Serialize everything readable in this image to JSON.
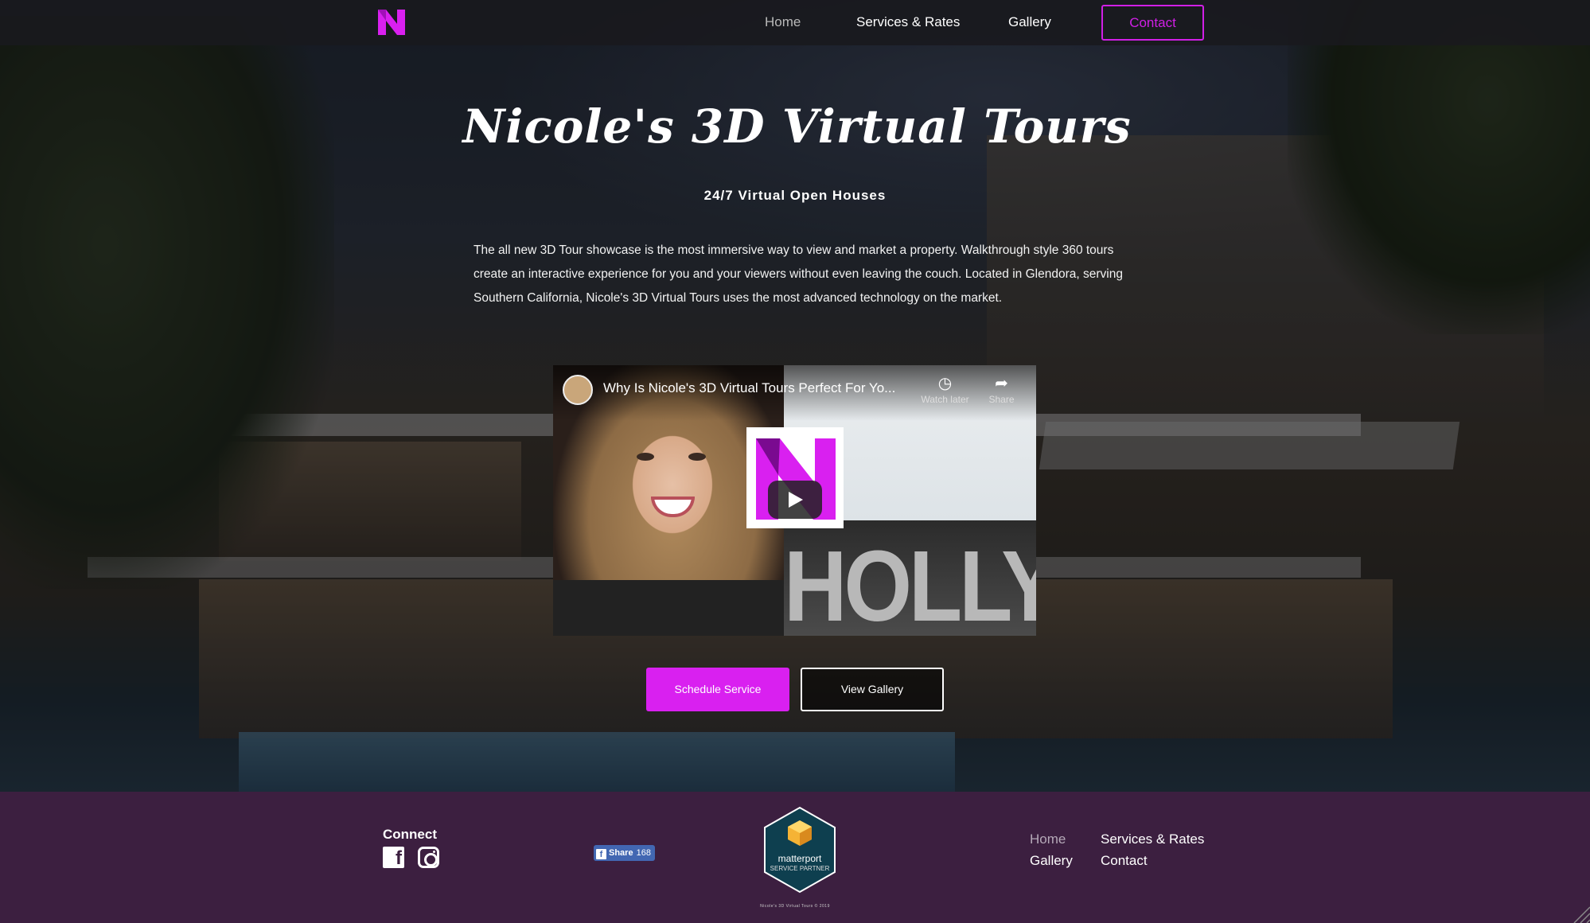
{
  "colors": {
    "accent": "#d920f0",
    "footer_bg": "#3c1f40",
    "nav_bg": "#19191e"
  },
  "nav": {
    "logo_icon": "n-logo-icon",
    "home": "Home",
    "services": "Services & Rates",
    "gallery": "Gallery",
    "contact": "Contact"
  },
  "hero": {
    "title": "Nicole's 3D Virtual Tours",
    "subtitle": "24/7 Virtual Open Houses",
    "description": "The all new 3D Tour showcase is the most immersive way to view and market a property. Walkthrough style 360 tours create an interactive experience for you and your viewers without even leaving the couch. Located in Glendora, serving Southern California, Nicole's 3D Virtual Tours uses the most advanced technology on the market."
  },
  "video": {
    "title": "Why Is Nicole's 3D Virtual Tours Perfect For Yo...",
    "watch_later": "Watch later",
    "share": "Share",
    "background_text": "HOLLYW",
    "play_icon": "play-icon"
  },
  "cta": {
    "schedule": "Schedule Service",
    "gallery": "View Gallery"
  },
  "footer": {
    "connect": "Connect",
    "fb_share_label": "Share",
    "fb_share_count": "168",
    "matterport_name": "matterport",
    "matterport_sub": "SERVICE PARTNER",
    "copyright": "Nicole's 3D Virtual Tours © 2019",
    "links": {
      "home": "Home",
      "services": "Services & Rates",
      "gallery": "Gallery",
      "contact": "Contact"
    }
  }
}
